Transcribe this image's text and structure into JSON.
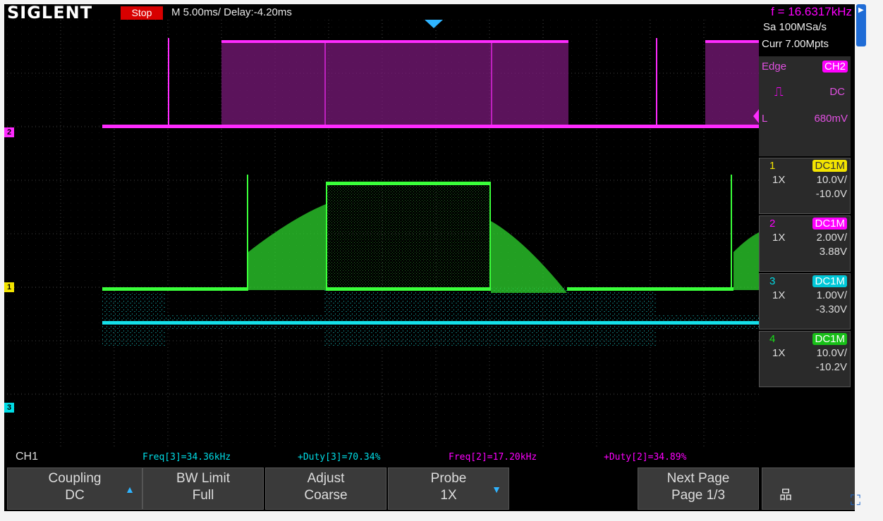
{
  "topbar": {
    "brand": "SIGLENT",
    "run_state": "Stop",
    "timebase": "M 5.00ms/ Delay:-4.20ms",
    "frequency": "f = 16.6317kHz"
  },
  "acquisition": {
    "sample_rate": "Sa 100MSa/s",
    "memory": "Curr 7.00Mpts"
  },
  "trigger": {
    "type": "Edge",
    "source": "CH2",
    "coupling": "DC",
    "level_label": "L",
    "level": "680mV",
    "slope_icon": "rising-edge-icon"
  },
  "channels": [
    {
      "num": "1",
      "coupling": "DC1M",
      "probe": "1X",
      "vdiv": "10.0V/",
      "offset": "-10.0V",
      "color": "#f3e400"
    },
    {
      "num": "2",
      "coupling": "DC1M",
      "probe": "1X",
      "vdiv": "2.00V/",
      "offset": "3.88V",
      "color": "#ff00ff"
    },
    {
      "num": "3",
      "coupling": "DC1M",
      "probe": "1X",
      "vdiv": "1.00V/",
      "offset": "-3.30V",
      "color": "#00dde6"
    },
    {
      "num": "4",
      "coupling": "DC1M",
      "probe": "1X",
      "vdiv": "10.0V/",
      "offset": "-10.2V",
      "color": "#18e018"
    }
  ],
  "markers": {
    "ch1": "1",
    "ch2": "2",
    "ch3": "3"
  },
  "selected_channel": "CH1",
  "measurements": [
    {
      "text": "Freq[3]=34.36kHz",
      "color": "#00dde6"
    },
    {
      "text": "+Duty[3]=70.34%",
      "color": "#00dde6"
    },
    {
      "text": "Freq[2]=17.20kHz",
      "color": "#ff00ff"
    },
    {
      "text": "+Duty[2]=34.89%",
      "color": "#ff00ff"
    }
  ],
  "softkeys": [
    {
      "title": "Coupling",
      "value": "DC"
    },
    {
      "title": "BW Limit",
      "value": "Full"
    },
    {
      "title": "Adjust",
      "value": "Coarse"
    },
    {
      "title": "Probe",
      "value": "1X"
    },
    {
      "title": "Next Page",
      "value": "Page 1/3"
    }
  ],
  "icons": {
    "network": "network-icon",
    "fullscreen": "fullscreen-icon",
    "trigger_marker": "trigger-position-icon"
  }
}
